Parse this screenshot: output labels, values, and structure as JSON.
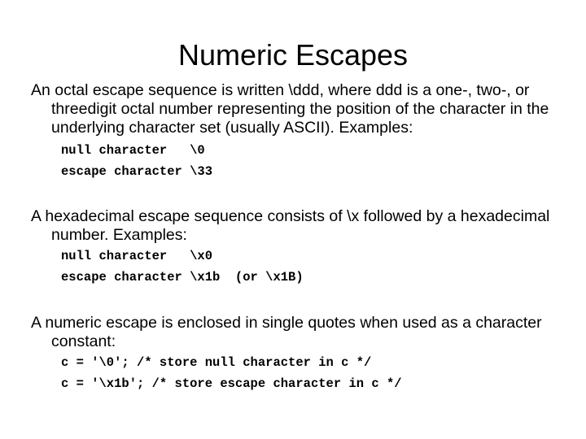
{
  "slide": {
    "title": "Numeric Escapes",
    "background_color": "#ffffff",
    "text_color": "#000000",
    "sections": [
      {
        "paragraph": "An octal escape sequence is written \\ddd, where ddd is a one-, two-, or threedigit octal number representing the position of the character in the underlying character set (usually ASCII). Examples:",
        "code": [
          "null character   \\0",
          "escape character \\33"
        ]
      },
      {
        "paragraph": "A hexadecimal escape sequence consists of \\x followed by a hexadecimal number. Examples:",
        "code": [
          "null character   \\x0",
          "escape character \\x1b  (or \\x1B)"
        ]
      },
      {
        "paragraph": "A numeric escape is enclosed in single quotes when used as a character constant:",
        "code": [
          "c = '\\0'; /* store null character in c */",
          "c = '\\x1b'; /* store escape character in c */"
        ]
      }
    ]
  }
}
